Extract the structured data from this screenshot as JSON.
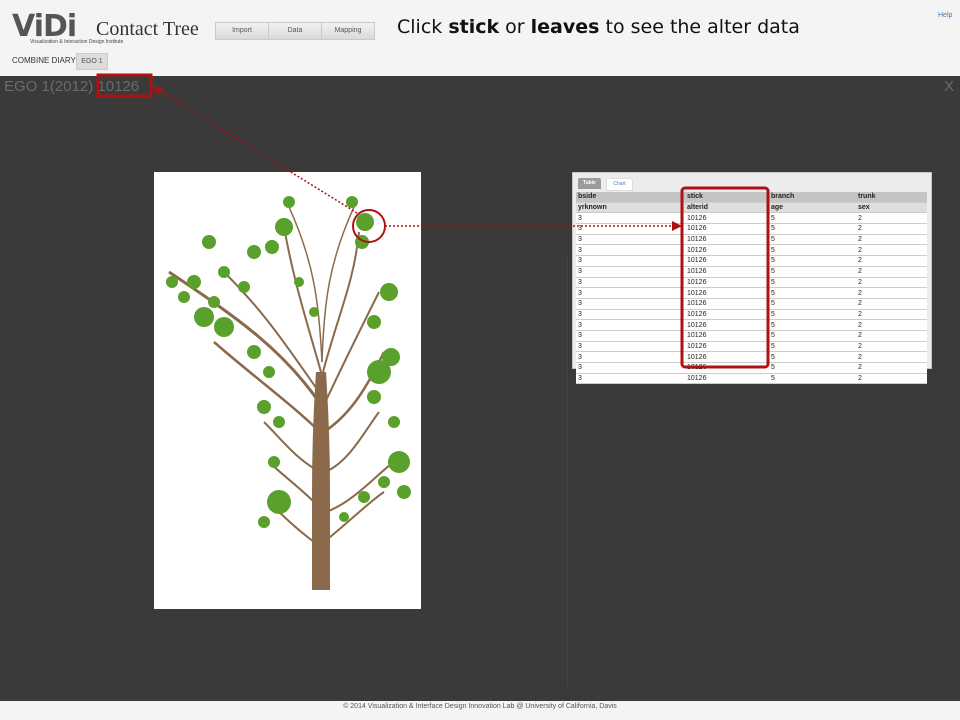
{
  "header": {
    "logo_text": "ViDi",
    "logo_subtitle": "Visualization & Interaction Design Institute",
    "app_title": "Contact Tree",
    "nav": [
      "Import",
      "Data",
      "Mapping"
    ],
    "instruction": {
      "pre": "Click ",
      "stick": "stick",
      "mid": " or ",
      "leaves": "leaves",
      "post": " to see the alter data"
    },
    "help": "Help",
    "combine_label": "COMBINE DIARY:",
    "ego_button": "EGO 1"
  },
  "panel": {
    "title_prefix": "EGO 1(2012)",
    "title_id": "10126",
    "close": "X"
  },
  "data_table": {
    "tabs": [
      "Table",
      "Chart"
    ],
    "header_row1": [
      "bside",
      "stick",
      "branch",
      "trunk"
    ],
    "header_row2": [
      "yrknown",
      "alterid",
      "age",
      "sex"
    ],
    "rows": [
      [
        "3",
        "10126",
        "5",
        "2"
      ],
      [
        "3",
        "10126",
        "5",
        "2"
      ],
      [
        "3",
        "10126",
        "5",
        "2"
      ],
      [
        "3",
        "10126",
        "5",
        "2"
      ],
      [
        "3",
        "10126",
        "5",
        "2"
      ],
      [
        "3",
        "10126",
        "5",
        "2"
      ],
      [
        "3",
        "10126",
        "5",
        "2"
      ],
      [
        "3",
        "10126",
        "5",
        "2"
      ],
      [
        "3",
        "10126",
        "5",
        "2"
      ],
      [
        "3",
        "10126",
        "5",
        "2"
      ],
      [
        "3",
        "10126",
        "5",
        "2"
      ],
      [
        "3",
        "10126",
        "5",
        "2"
      ],
      [
        "3",
        "10126",
        "5",
        "2"
      ],
      [
        "3",
        "10126",
        "5",
        "2"
      ],
      [
        "3",
        "10126",
        "5",
        "2"
      ],
      [
        "3",
        "10126",
        "5",
        "2"
      ]
    ]
  },
  "colors": {
    "trunk": "#8a6a4a",
    "leaf": "#5aa02c",
    "highlight": "#b01010",
    "panel_bg": "#3a3a3a"
  },
  "footer": "© 2014 Visualization & Interface Design Innovation Lab @ University of California, Davis"
}
